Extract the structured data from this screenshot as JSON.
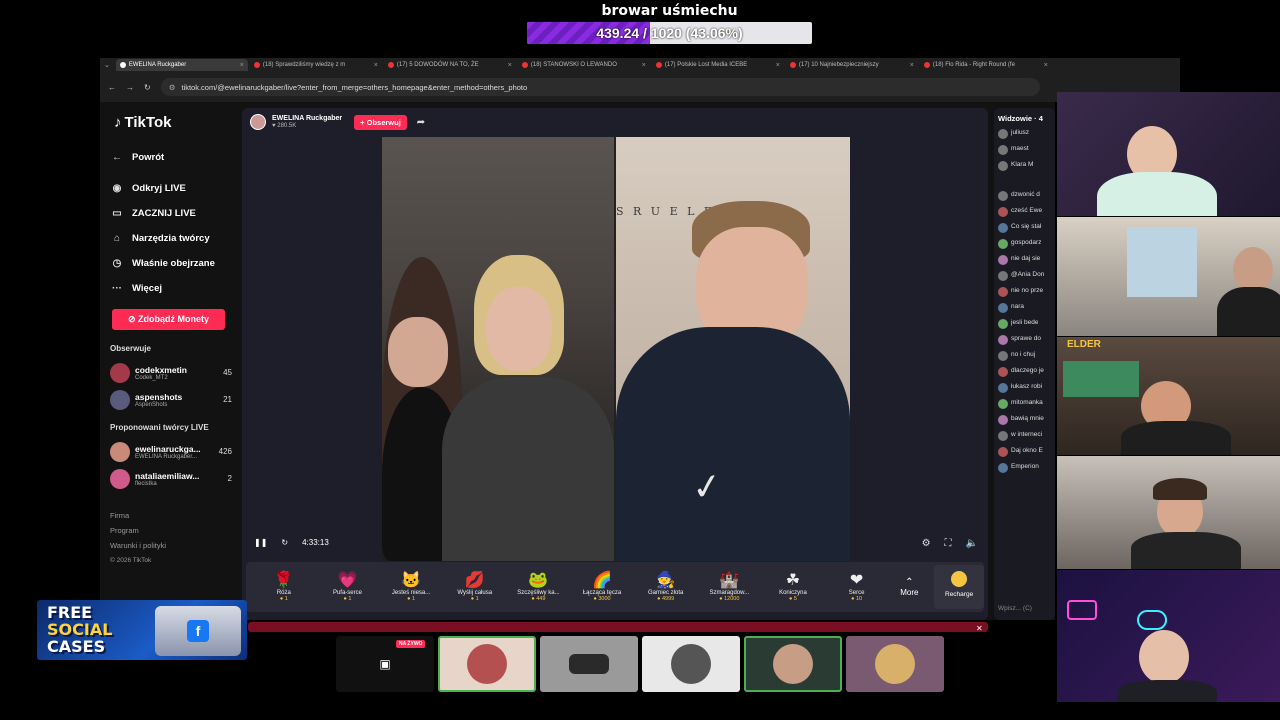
{
  "overlay": {
    "goal_title": "browar uśmiechu",
    "goal_text": "439.24 / 1020 (43.06%)",
    "goal_progress": 0.4306,
    "goal_color": "#8a2be2"
  },
  "browser": {
    "tabs": [
      {
        "label": "EWELINA Ruckgaber",
        "active": true
      },
      {
        "label": "(18) Sprawdziliśmy wiedzę z m"
      },
      {
        "label": "(17) 5 DOWODÓW NA TO, ŻE"
      },
      {
        "label": "(18) STANOWSKI O LEWANDO"
      },
      {
        "label": "(17) Polskie Lost Media ICEBE"
      },
      {
        "label": "(17) 10 Najniebezpieczniejszy"
      },
      {
        "label": "(18) Flo Rida - Right Round (fe"
      }
    ],
    "url": "tiktok.com/@ewelinaruckgaber/live?enter_from_merge=others_homepage&enter_method=others_photo"
  },
  "sidebar": {
    "logo": "TikTok",
    "back": "Powrót",
    "nav": [
      {
        "label": "Odkryj LIVE",
        "icon": "live-discover-icon"
      },
      {
        "label": "ZACZNIJ LIVE",
        "icon": "camera-icon"
      },
      {
        "label": "Narzędzia twórcy",
        "icon": "creator-tools-icon"
      },
      {
        "label": "Właśnie obejrzane",
        "icon": "history-icon"
      },
      {
        "label": "Więcej",
        "icon": "more-icon"
      }
    ],
    "coins_button": "Zdobądź Monety",
    "following_heading": "Obserwuje",
    "following": [
      {
        "name": "codekxmetin",
        "sub": "Codek_MT2",
        "count": "45"
      },
      {
        "name": "aspenshots",
        "sub": "AspenShots",
        "count": "21"
      }
    ],
    "suggested_heading": "Proponowani twórcy LIVE",
    "suggested": [
      {
        "name": "ewelinaruckga...",
        "sub": "EWELINA Ruckgaber...",
        "count": "426"
      },
      {
        "name": "nataliaemiliaw...",
        "sub": "flecistka",
        "count": "2"
      }
    ],
    "footer": [
      "Firma",
      "Program",
      "Warunki i polityki"
    ],
    "copyright": "© 2026 TikTok"
  },
  "stream": {
    "host_name": "EWELINA Ruckgaber",
    "host_followers": "280.5K",
    "follow_button": "+ Obserwuj",
    "time": "4:33:13",
    "gifts": [
      {
        "name": "Róża",
        "price": "1",
        "glyph": "🌹"
      },
      {
        "name": "Pufa-serce",
        "price": "1",
        "glyph": "💗"
      },
      {
        "name": "Jesteś niesa...",
        "price": "1",
        "glyph": "🐱"
      },
      {
        "name": "Wyślij całusa",
        "price": "1",
        "glyph": "💋"
      },
      {
        "name": "Szczęśliwy ka...",
        "price": "449",
        "glyph": "🐸"
      },
      {
        "name": "Łącząca tęcza",
        "price": "3000",
        "glyph": "🌈"
      },
      {
        "name": "Garniec złota",
        "price": "4999",
        "glyph": "🧙"
      },
      {
        "name": "Szmaragdow...",
        "price": "12000",
        "glyph": "🏰"
      },
      {
        "name": "Koniczyna",
        "price": "5",
        "glyph": "☘"
      },
      {
        "name": "Serce",
        "price": "10",
        "glyph": "❤"
      }
    ],
    "more": "More",
    "recharge": "Recharge"
  },
  "chat": {
    "viewers_heading": "Widzowie · 4",
    "viewers": [
      "juliusz",
      "maest",
      "Klara M"
    ],
    "lines": [
      "dzwonić d",
      "cześć Ewe",
      "Co się stał",
      "gospodarz",
      "nie daj sie",
      "@Ania Don",
      "nie no prze",
      "nara",
      "jesli bede",
      "sprawe do",
      "no i chuj",
      "dlaczego je",
      "łukasz robi",
      "mitomanka",
      "bawią mnie",
      "w interneci",
      "Daj okno E",
      "Emperion"
    ],
    "input_placeholder": "Wpisz... (C)"
  },
  "cams": {
    "cam3_label": "ELDER"
  },
  "bottom": {
    "live_badge": "NA ŻYWO"
  },
  "banner": {
    "line1": "FREE",
    "line2": "SOCIAL",
    "line3": "CASES",
    "icon": "f"
  }
}
